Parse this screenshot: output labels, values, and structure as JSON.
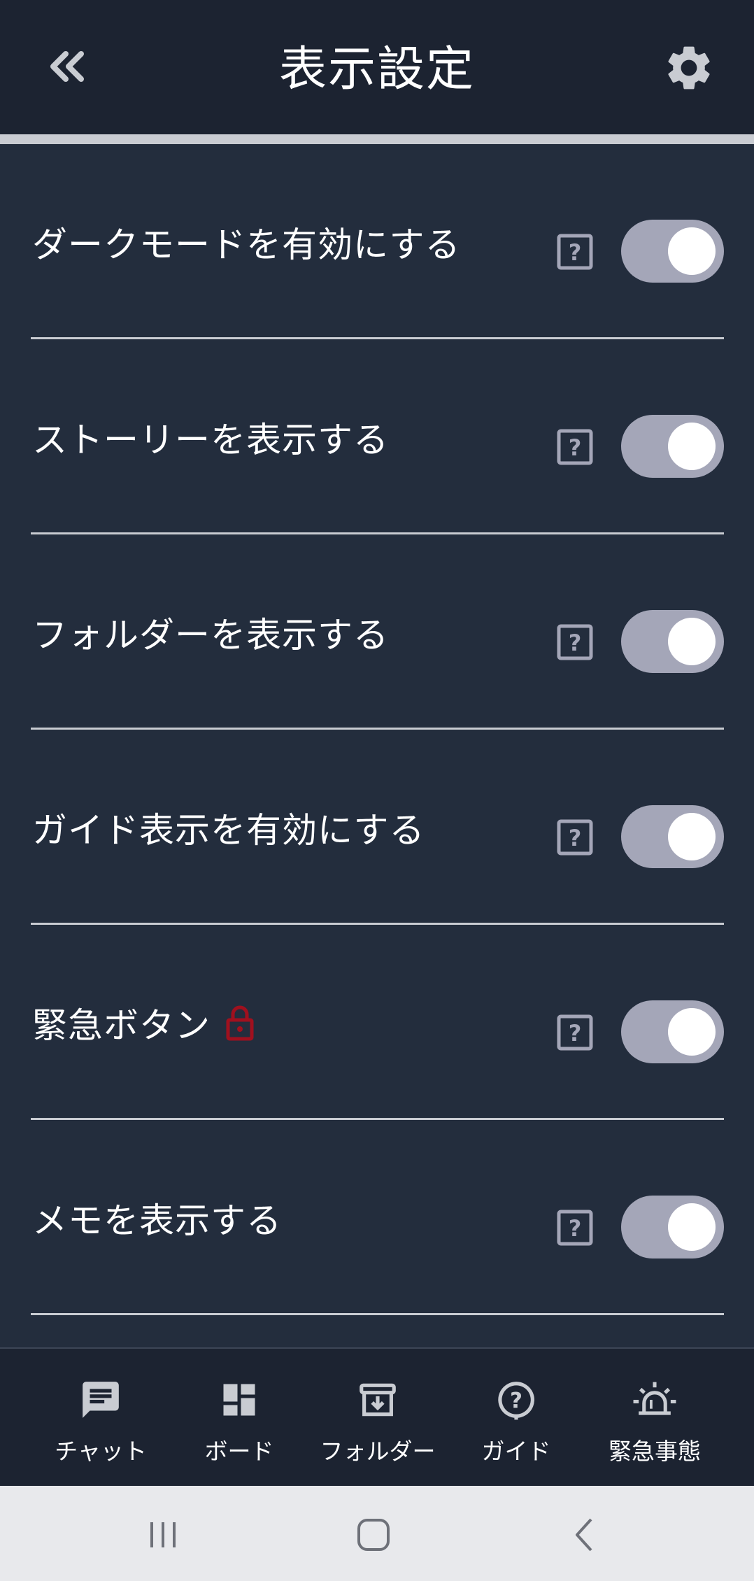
{
  "header": {
    "title": "表示設定",
    "back_icon": "double-chevron-left-icon",
    "settings_icon": "gear-icon"
  },
  "settings": [
    {
      "label": "ダークモードを有効にする",
      "enabled": true,
      "locked": false
    },
    {
      "label": "ストーリーを表示する",
      "enabled": true,
      "locked": false
    },
    {
      "label": "フォルダーを表示する",
      "enabled": true,
      "locked": false
    },
    {
      "label": "ガイド表示を有効にする",
      "enabled": true,
      "locked": false
    },
    {
      "label": "緊急ボタン",
      "enabled": true,
      "locked": true
    },
    {
      "label": "メモを表示する",
      "enabled": true,
      "locked": false
    }
  ],
  "nav": [
    {
      "label": "チャット",
      "icon": "chat-icon"
    },
    {
      "label": "ボード",
      "icon": "dashboard-icon"
    },
    {
      "label": "フォルダー",
      "icon": "archive-icon"
    },
    {
      "label": "ガイド",
      "icon": "help-circle-icon"
    },
    {
      "label": "緊急事態",
      "icon": "siren-icon"
    }
  ],
  "colors": {
    "header_bg": "#1c2331",
    "content_bg": "#232d3d",
    "toggle_track": "#a4a6b8",
    "lock": "#a0101e",
    "help": "#a4a6b8"
  }
}
